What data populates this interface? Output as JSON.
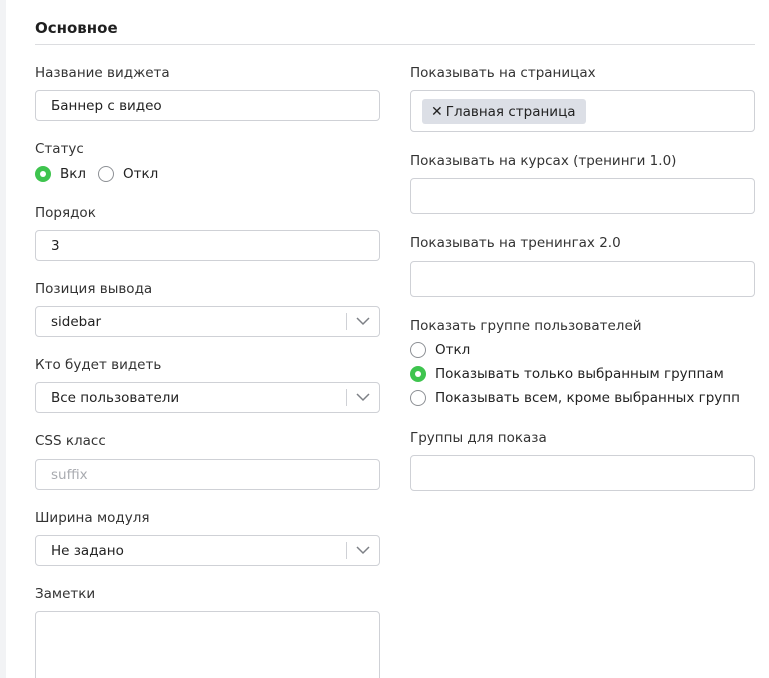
{
  "section": {
    "title": "Основное"
  },
  "left": {
    "widget_name": {
      "label": "Название виджета",
      "value": "Баннер с видео"
    },
    "status": {
      "label": "Статус",
      "options": [
        {
          "label": "Вкл",
          "checked": true
        },
        {
          "label": "Откл",
          "checked": false
        }
      ]
    },
    "order": {
      "label": "Порядок",
      "value": "3"
    },
    "position": {
      "label": "Позиция вывода",
      "value": "sidebar"
    },
    "audience": {
      "label": "Кто будет видеть",
      "value": "Все пользователи"
    },
    "css_class": {
      "label": "CSS класс",
      "placeholder": "suffix"
    },
    "module_width": {
      "label": "Ширина модуля",
      "value": "Не задано"
    },
    "notes": {
      "label": "Заметки",
      "value": ""
    }
  },
  "right": {
    "show_on_pages": {
      "label": "Показывать на страницах",
      "tags": [
        "Главная страница"
      ]
    },
    "show_on_courses": {
      "label": "Показывать на курсах (тренинги 1.0)",
      "value": ""
    },
    "show_on_trainings": {
      "label": "Показывать на тренингах 2.0",
      "value": ""
    },
    "user_groups": {
      "label": "Показать группе пользователей",
      "options": [
        {
          "label": "Откл",
          "checked": false
        },
        {
          "label": "Показывать только выбранным группам",
          "checked": true
        },
        {
          "label": "Показывать всем, кроме выбранных групп",
          "checked": false
        }
      ]
    },
    "display_groups": {
      "label": "Группы для показа",
      "value": ""
    }
  },
  "colors": {
    "accent": "#3ec44e",
    "border": "#cfd1d6",
    "tag_bg": "#dcdfe6"
  },
  "icons": {
    "select_arrow": "chevron-down-icon",
    "tag_remove": "close-icon"
  }
}
